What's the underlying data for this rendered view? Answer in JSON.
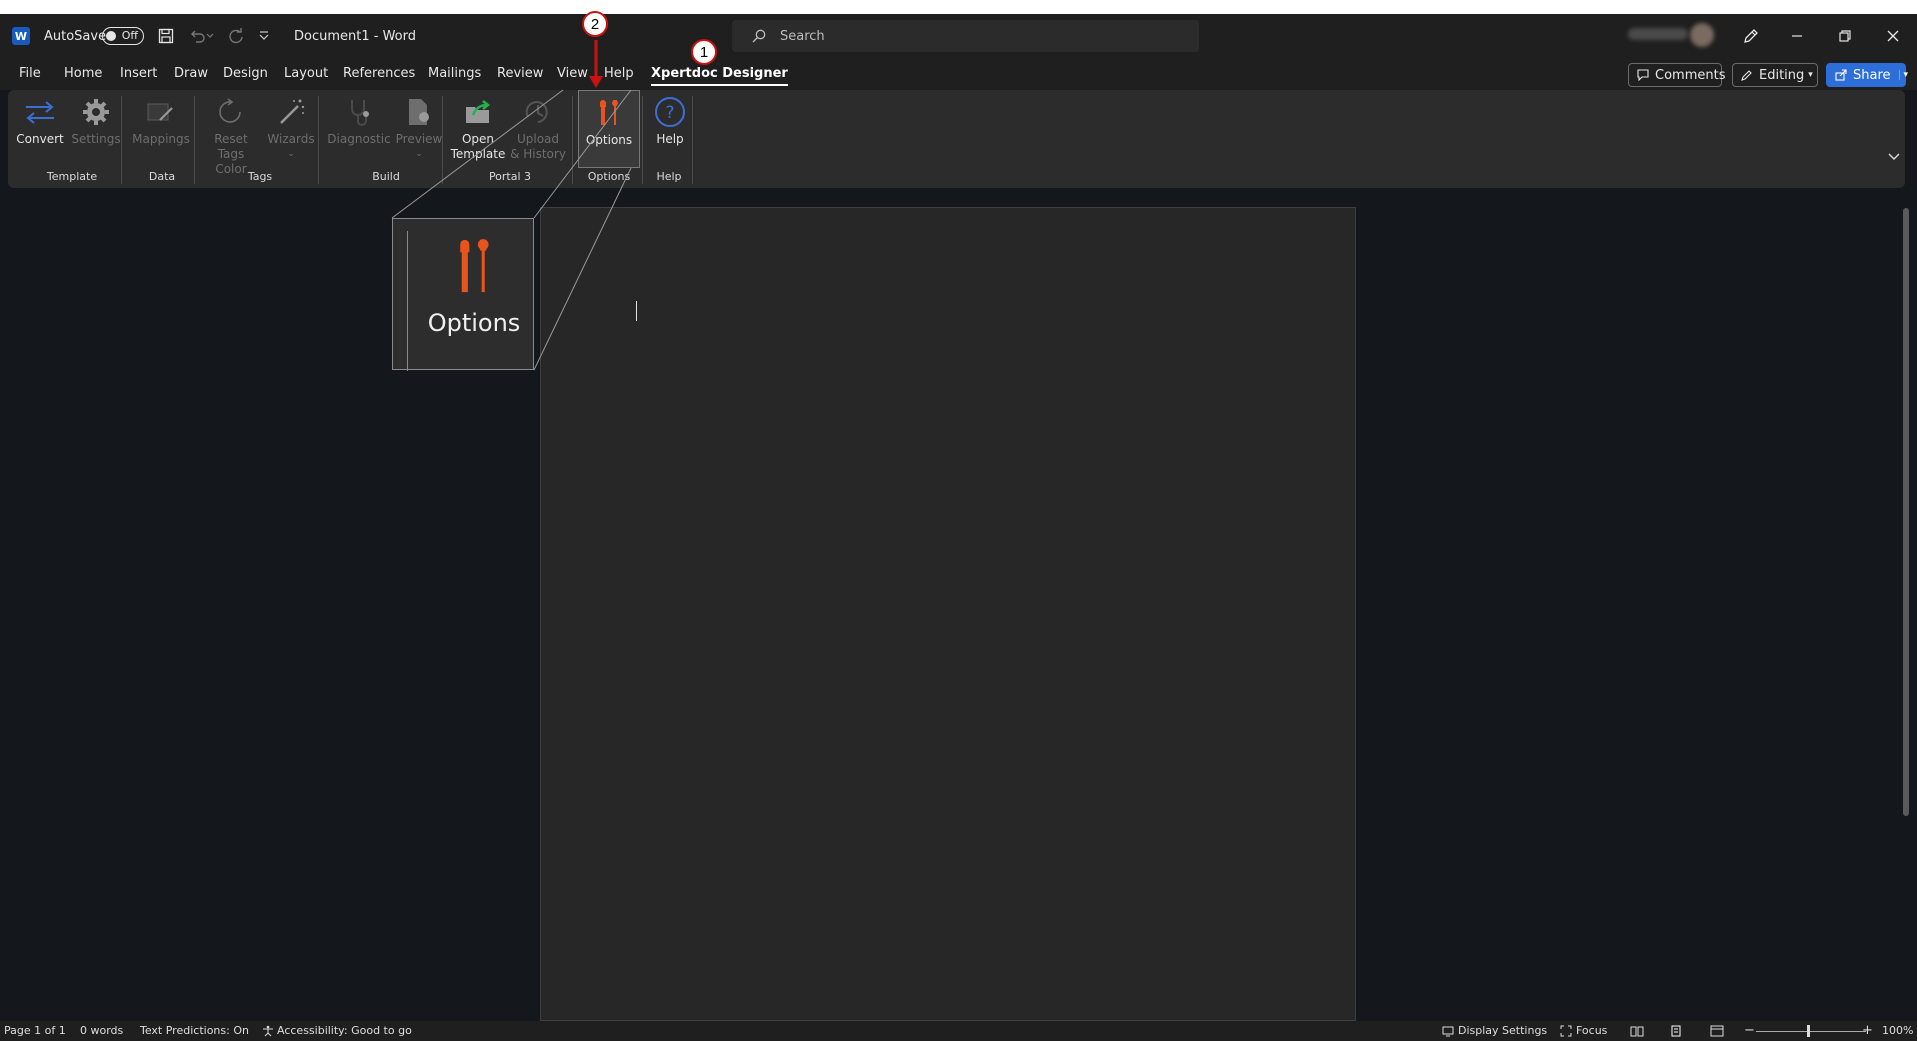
{
  "titlebar": {
    "autosave_label": "AutoSave",
    "autosave_state": "Off",
    "doc_title": "Document1  -  Word",
    "search_placeholder": "Search",
    "app_icon_letter": "W"
  },
  "menu": {
    "tabs": [
      "File",
      "Home",
      "Insert",
      "Draw",
      "Design",
      "Layout",
      "References",
      "Mailings",
      "Review",
      "View",
      "Help",
      "Xpertdoc Designer"
    ],
    "active_tab": "Xpertdoc Designer"
  },
  "right_buttons": {
    "comments": "Comments",
    "editing": "Editing",
    "share": "Share"
  },
  "ribbon": {
    "buttons": {
      "convert": "Convert",
      "settings": "Settings",
      "mappings": "Mappings",
      "reset_tags": "Reset Tags\nColor",
      "wizards": "Wizards",
      "diagnostic": "Diagnostic",
      "preview": "Preview",
      "open_template": "Open\nTemplate",
      "upload_history": "Upload\n& History",
      "options": "Options",
      "help": "Help"
    },
    "groups": {
      "template": "Template",
      "data": "Data",
      "tags": "Tags",
      "build": "Build",
      "portal": "Portal 3",
      "options": "Options",
      "help": "Help"
    }
  },
  "zoom_callout": {
    "label": "Options"
  },
  "annotations": {
    "step1": "1",
    "step2": "2"
  },
  "statusbar": {
    "page": "Page 1 of 1",
    "words": "0 words",
    "predictions": "Text Predictions: On",
    "accessibility": "Accessibility: Good to go",
    "display_settings": "Display Settings",
    "focus": "Focus",
    "zoom": "100%"
  },
  "colors": {
    "accent_red": "#cc1111",
    "share_blue": "#2d6ed8",
    "options_orange": "#e8541e"
  }
}
